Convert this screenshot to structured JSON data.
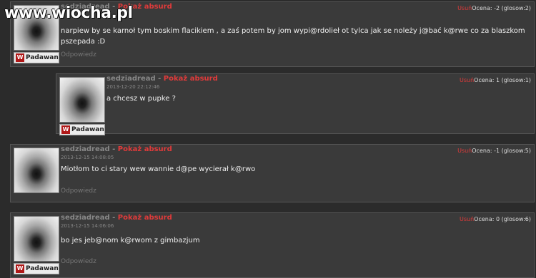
{
  "watermark": "www.wiocha.pl",
  "comments": [
    {
      "author": "sedziadread",
      "separator": "-",
      "absurd": "Pokaż absurd",
      "date": "",
      "text_lines": [
        "narpiew by se karnoł tym boskim flacikiem , a zaś potem by jom wypi@rdolieł ot tylca jak se noleży j@bać k@rwe co za blaszkom",
        "pszepada :D"
      ],
      "reply": "Odpowiedz",
      "delete": "Usuń",
      "rating": "Ocena: -2 (glosow:2)",
      "rank": "Padawan"
    },
    {
      "author": "sedziadread",
      "separator": "-",
      "absurd": "Pokaż absurd",
      "date": "2013-12-20 22:12:46",
      "text_lines": [
        "a chcesz w pupke ?"
      ],
      "reply": "",
      "delete": "Usuń",
      "rating": "Ocena: 1 (glosow:1)",
      "rank": "Padawan"
    },
    {
      "author": "sedziadread",
      "separator": "-",
      "absurd": "Pokaż absurd",
      "date": "2013-12-15 14:08:05",
      "text_lines": [
        "Miotłom to ci stary wew wannie d@pe wycierał k@rwo"
      ],
      "reply": "Odpowiedz",
      "delete": "Usuń",
      "rating": "Ocena: -1 (glosow:5)",
      "rank": ""
    },
    {
      "author": "sedziadread",
      "separator": "-",
      "absurd": "Pokaż absurd",
      "date": "2013-12-15 14:06:06",
      "text_lines": [
        "bo jes jeb@nom k@rwom z gimbazjum"
      ],
      "reply": "Odpowiedz",
      "delete": "Usuń",
      "rating": "Ocena: 0 (glosow:6)",
      "rank": "Padawan"
    }
  ]
}
